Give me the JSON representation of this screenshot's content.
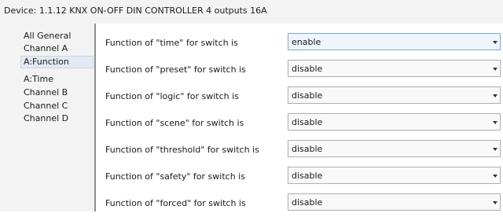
{
  "device": {
    "title": "Device: 1.1.12  KNX ON-OFF DIN CONTROLLER 4 outputs 16A"
  },
  "sidebar": {
    "items": [
      {
        "label": "All General"
      },
      {
        "label": "Channel A"
      },
      {
        "label": "A:Function",
        "selected": true
      },
      {
        "label": "A:Time"
      },
      {
        "label": "Channel B"
      },
      {
        "label": "Channel C"
      },
      {
        "label": "Channel D"
      }
    ]
  },
  "params": [
    {
      "label": "Function of \"time\" for switch is",
      "value": "enable"
    },
    {
      "label": "Function of \"preset\" for switch is",
      "value": "disable"
    },
    {
      "label": "Function of \"logic\" for switch is",
      "value": "disable"
    },
    {
      "label": "Function of \"scene\" for switch is",
      "value": "disable"
    },
    {
      "label": "Function of \"threshold\" for switch is",
      "value": "disable"
    },
    {
      "label": "Function of \"safety\" for switch is",
      "value": "disable"
    },
    {
      "label": "Function of \"forced\" for switch is",
      "value": "disable"
    }
  ]
}
